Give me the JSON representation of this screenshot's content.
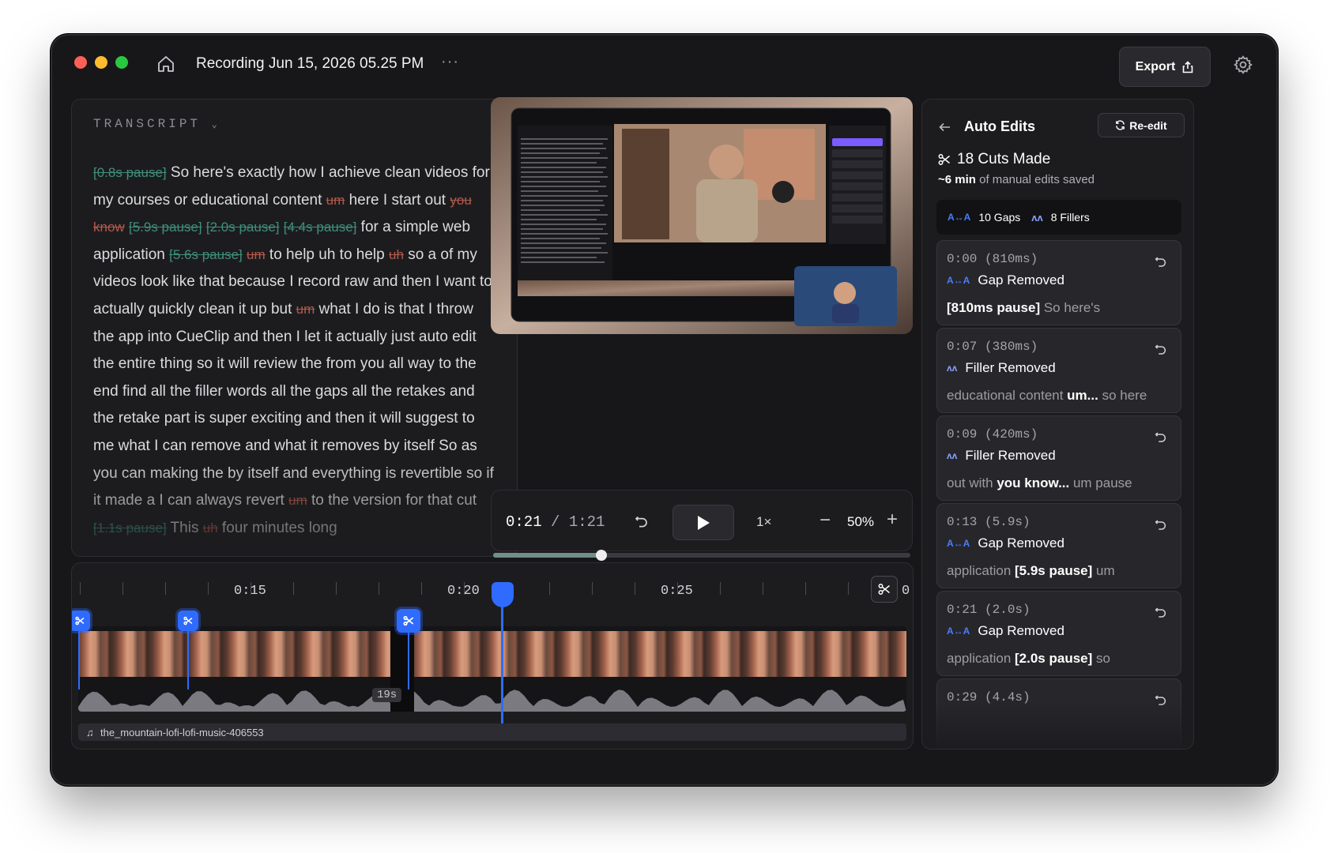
{
  "window": {
    "title": "Recording Jun 15, 2026 05.25 PM",
    "more_label": "···"
  },
  "toolbar": {
    "export_label": "Export"
  },
  "transcript": {
    "header": "TRANSCRIPT",
    "segments": [
      {
        "type": "cut",
        "text": "[0.8s pause]"
      },
      {
        "type": "text",
        "text": " So here's exactly how I achieve clean videos for my courses or educational content "
      },
      {
        "type": "fill",
        "text": "um"
      },
      {
        "type": "text",
        "text": " here I start out "
      },
      {
        "type": "fill",
        "text": "you know"
      },
      {
        "type": "text",
        "text": " "
      },
      {
        "type": "cut",
        "text": "[5.9s pause]"
      },
      {
        "type": "text",
        "text": " "
      },
      {
        "type": "cut",
        "text": "[2.0s pause]"
      },
      {
        "type": "text",
        "text": " "
      },
      {
        "type": "cut",
        "text": "[4.4s pause]"
      },
      {
        "type": "text",
        "text": " for a simple web application "
      },
      {
        "type": "cut",
        "text": "[5.6s pause]"
      },
      {
        "type": "text",
        "text": " "
      },
      {
        "type": "fill",
        "text": "um"
      },
      {
        "type": "text",
        "text": " to help uh to help "
      },
      {
        "type": "fill",
        "text": "uh"
      },
      {
        "type": "text",
        "text": " so a of my videos look like that because I record raw and then I want to actually quickly clean it up but "
      },
      {
        "type": "fill",
        "text": "um"
      },
      {
        "type": "text",
        "text": " what I do is that I throw the app into CueClip and then I let it actually just auto edit the entire thing so it will review the from you all way to the end find all the filler words all the gaps all the retakes and the retake part is super exciting and then it will suggest to me what I can remove and what it removes by itself So as you can making the by itself and everything is revertible so if it made a I can always revert "
      },
      {
        "type": "fill",
        "text": "um"
      },
      {
        "type": "text",
        "text": " to the version for that cut "
      },
      {
        "type": "cut",
        "text": "[1.1s pause]"
      },
      {
        "type": "text",
        "text": " This "
      },
      {
        "type": "fill",
        "text": "uh"
      },
      {
        "type": "text",
        "text": " four minutes long"
      }
    ]
  },
  "playback": {
    "current": "0:21",
    "separator": " / ",
    "duration": "1:21",
    "speed": "1×",
    "zoom": "50%",
    "progress": 0.26
  },
  "auto_edits": {
    "title": "Auto Edits",
    "reedit_label": "Re-edit",
    "cuts_made": "18 Cuts Made",
    "saved_bold": "~6 min",
    "saved_rest": " of manual edits saved",
    "gaps_label": "10 Gaps",
    "fillers_label": "8 Fillers",
    "cards": [
      {
        "time": "0:00 (810ms)",
        "type": "Gap Removed",
        "kind": "gap",
        "pre": "",
        "bold": "[810ms pause]",
        "post": " So here's"
      },
      {
        "time": "0:07 (380ms)",
        "type": "Filler Removed",
        "kind": "filler",
        "pre": "educational content ",
        "bold": "um...",
        "post": " so here"
      },
      {
        "time": "0:09 (420ms)",
        "type": "Filler Removed",
        "kind": "filler",
        "pre": "out with ",
        "bold": "you know...",
        "post": " um pause"
      },
      {
        "time": "0:13 (5.9s)",
        "type": "Gap Removed",
        "kind": "gap",
        "pre": "application ",
        "bold": "[5.9s pause]",
        "post": " um"
      },
      {
        "time": "0:21 (2.0s)",
        "type": "Gap Removed",
        "kind": "gap",
        "pre": "application ",
        "bold": "[2.0s pause]",
        "post": " so"
      },
      {
        "time": "0:29 (4.4s)",
        "type": "",
        "kind": "gap",
        "pre": "",
        "bold": "",
        "post": ""
      }
    ]
  },
  "timeline": {
    "ticks": [
      "0:15",
      "0:20",
      "0:25"
    ],
    "edge_label": "0",
    "gap_duration": "19s",
    "music_track": "the_mountain-lofi-lofi-music-406553"
  },
  "colors": {
    "accent": "#2f6bff",
    "gap_strike": "#3f8f78",
    "filler_strike": "#b35a4a"
  }
}
